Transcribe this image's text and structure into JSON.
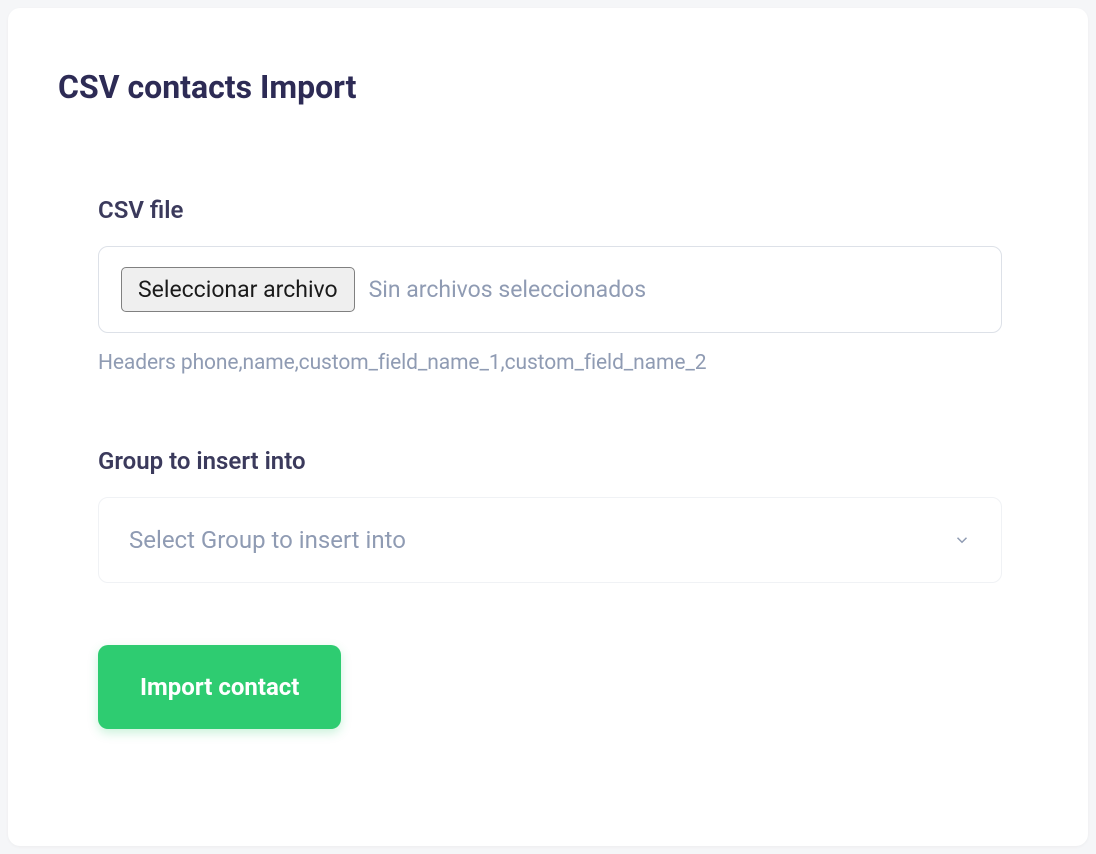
{
  "page": {
    "title": "CSV contacts Import"
  },
  "csv_file": {
    "label": "CSV file",
    "button_label": "Seleccionar archivo",
    "status_text": "Sin archivos seleccionados",
    "help_text": "Headers phone,name,custom_field_name_1,custom_field_name_2"
  },
  "group_select": {
    "label": "Group to insert into",
    "placeholder": "Select Group to insert into"
  },
  "submit": {
    "label": "Import contact"
  }
}
